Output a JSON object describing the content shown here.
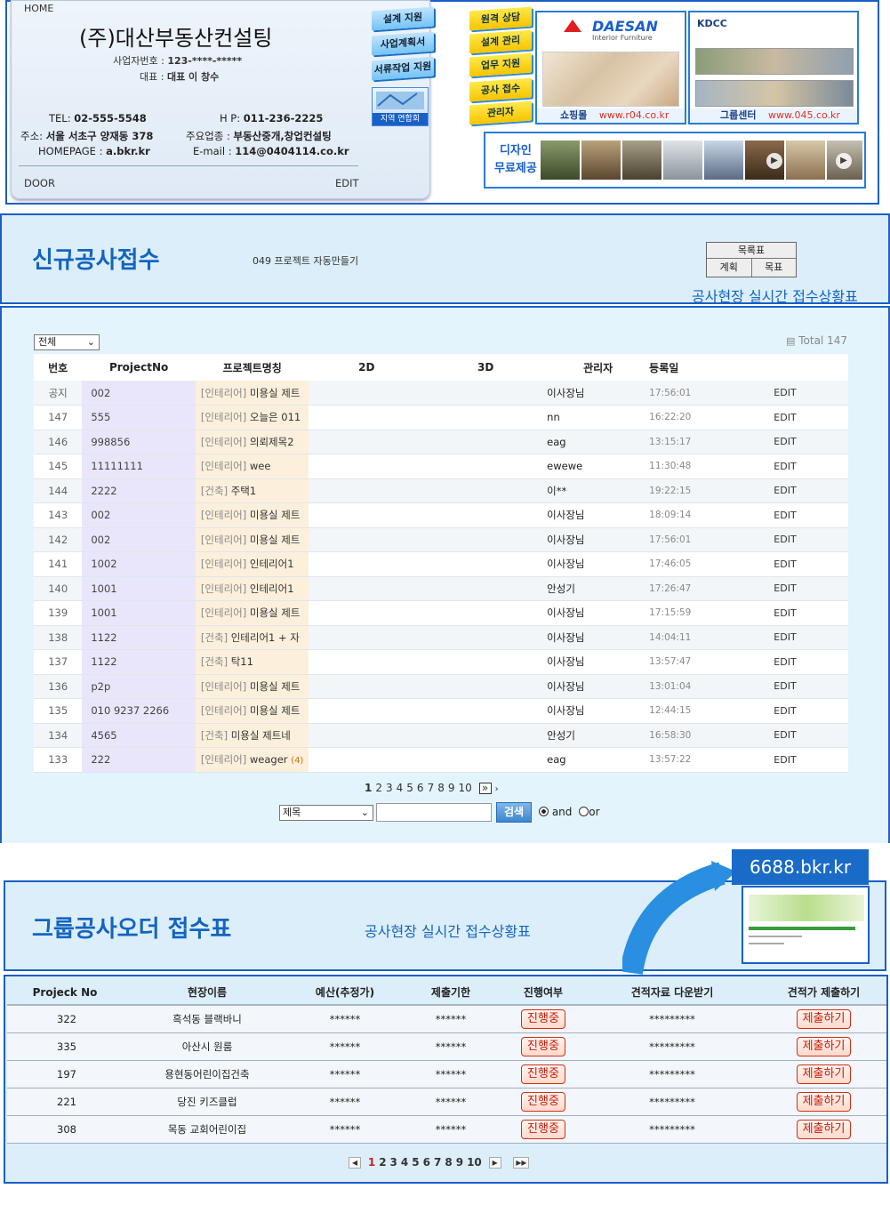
{
  "card": {
    "home": "HOME",
    "company": "(주)대산부동산컨설팅",
    "bizno_label": "사업자번호 : ",
    "bizno": "123-****-*****",
    "ceo_label": "대표 : ",
    "ceo": "대표 이 창수",
    "tel_label": "TEL: ",
    "tel": "02-555-5548",
    "hp_label": "H P: ",
    "hp": "011-236-2225",
    "addr_label": "주소: ",
    "addr": "서울 서초구 양재동 378",
    "biz_label": "주요업종 : ",
    "biz": "부동산중개,창업컨설팅",
    "homepage_label": "HOMEPAGE : ",
    "homepage": "a.bkr.kr",
    "email_label": "E-mail : ",
    "email": "114@0404114.co.kr",
    "door": "DOOR",
    "edit": "EDIT"
  },
  "side_buttons": [
    "설계 지원",
    "사업계획서",
    "서류작업 지원"
  ],
  "region_banner": "지역 연합회",
  "yellow_buttons": [
    "원격 상담",
    "설계 관리",
    "업무 지원",
    "공사 접수",
    "관리자"
  ],
  "daesan": {
    "brand": "DAESAN",
    "sub": "Interior Furniture",
    "label": "쇼핑몰",
    "url": "www.r04.co.kr"
  },
  "kdcc": {
    "brand": "KDCC",
    "label": "그룹센터",
    "url": "www.045.co.kr"
  },
  "design": {
    "line1": "디자인",
    "line2": "무료제공"
  },
  "section1": {
    "title": "신규공사접수",
    "subtitle": "049 프로젝트 자동만들기",
    "menu_top": "목록표",
    "menu_left": "계획",
    "menu_right": "목표",
    "realtime": "공사현장 실시간 접수상황표",
    "filter": "전체",
    "total": "Total 147",
    "headers": [
      "번호",
      "ProjectNo",
      "프로젝트명칭",
      "2D",
      "3D",
      "관리자",
      "등록일"
    ],
    "rows": [
      {
        "no": "공지",
        "pno": "002",
        "cat": "[인테리어]",
        "name": " 미용실 제트",
        "mgr": "이사장님",
        "date": "17:56:01",
        "edit": "EDIT"
      },
      {
        "no": "147",
        "pno": "555",
        "cat": "[인테리어]",
        "name": " 오늘은 011",
        "mgr": "nn",
        "date": "16:22:20",
        "edit": "EDIT"
      },
      {
        "no": "146",
        "pno": "998856",
        "cat": "[인테리어]",
        "name": " 의뢰제목2",
        "mgr": "eag",
        "date": "13:15:17",
        "edit": "EDIT"
      },
      {
        "no": "145",
        "pno": "11111111",
        "cat": "[인테리어]",
        "name": " wee",
        "mgr": "ewewe",
        "date": "11:30:48",
        "edit": "EDIT"
      },
      {
        "no": "144",
        "pno": "2222",
        "cat": "[건축]",
        "name": " 주택1",
        "mgr": "이**",
        "date": "19:22:15",
        "edit": "EDIT"
      },
      {
        "no": "143",
        "pno": "002",
        "cat": "[인테리어]",
        "name": " 미용실 제트",
        "mgr": "이사장님",
        "date": "18:09:14",
        "edit": "EDIT"
      },
      {
        "no": "142",
        "pno": "002",
        "cat": "[인테리어]",
        "name": " 미용실 제트",
        "mgr": "이사장님",
        "date": "17:56:01",
        "edit": "EDIT"
      },
      {
        "no": "141",
        "pno": "1002",
        "cat": "[인테리어]",
        "name": " 인테리어1",
        "mgr": "이사장님",
        "date": "17:46:05",
        "edit": "EDIT"
      },
      {
        "no": "140",
        "pno": "1001",
        "cat": "[인테리어]",
        "name": " 인테리어1",
        "mgr": "안성기",
        "date": "17:26:47",
        "edit": "EDIT"
      },
      {
        "no": "139",
        "pno": "1001",
        "cat": "[인테리어]",
        "name": " 미용실 제트",
        "mgr": "이사장님",
        "date": "17:15:59",
        "edit": "EDIT"
      },
      {
        "no": "138",
        "pno": "1122",
        "cat": "[건축]",
        "name": " 인테리어1 + 자",
        "mgr": "이사장님",
        "date": "14:04:11",
        "edit": "EDIT"
      },
      {
        "no": "137",
        "pno": "1122",
        "cat": "[건축]",
        "name": " 탁11",
        "mgr": "이사장님",
        "date": "13:57:47",
        "edit": "EDIT"
      },
      {
        "no": "136",
        "pno": "p2p",
        "cat": "[인테리어]",
        "name": " 미용실 제트",
        "mgr": "이사장님",
        "date": "13:01:04",
        "edit": "EDIT"
      },
      {
        "no": "135",
        "pno": "010 9237 2266",
        "cat": "[인테리어]",
        "name": " 미용실 제트",
        "mgr": "이사장님",
        "date": "12:44:15",
        "edit": "EDIT"
      },
      {
        "no": "134",
        "pno": "4565",
        "cat": "[건축]",
        "name": " 미용실 제트네",
        "mgr": "안성기",
        "date": "16:58:30",
        "edit": "EDIT"
      },
      {
        "no": "133",
        "pno": "222",
        "cat": "[인테리어]",
        "name": " weager",
        "comment": "(4)",
        "mgr": "eag",
        "date": "13:57:22",
        "edit": "EDIT"
      }
    ],
    "pages": [
      "1",
      "2",
      "3",
      "4",
      "5",
      "6",
      "7",
      "8",
      "9",
      "10"
    ],
    "search_field": "제목",
    "search_button": "검색",
    "and_label": "and",
    "or_label": "or"
  },
  "section2": {
    "title": "그룹공사오더 접수표",
    "realtime": "공사현장 실시간 접수상황표",
    "site": "6688.bkr.kr",
    "headers": [
      "Projeck No",
      "현장이름",
      "예산(추정가)",
      "제출기한",
      "진행여부",
      "견적자료 다운받기",
      "견적가 제출하기"
    ],
    "rows": [
      {
        "no": "322",
        "name": "흑석동 블랙바니",
        "budget": "******",
        "due": "******",
        "status": "진행중",
        "download": "*********",
        "submit": "제출하기"
      },
      {
        "no": "335",
        "name": "아산시 원룸",
        "budget": "******",
        "due": "******",
        "status": "진행중",
        "download": "*********",
        "submit": "제출하기"
      },
      {
        "no": "197",
        "name": "용현동어린이집건축",
        "budget": "******",
        "due": "******",
        "status": "진행중",
        "download": "*********",
        "submit": "제출하기"
      },
      {
        "no": "221",
        "name": "당진 키즈클럽",
        "budget": "******",
        "due": "******",
        "status": "진행중",
        "download": "*********",
        "submit": "제출하기"
      },
      {
        "no": "308",
        "name": "목동 교회어린이집",
        "budget": "******",
        "due": "******",
        "status": "진행중",
        "download": "*********",
        "submit": "제출하기"
      }
    ],
    "pages": [
      "1",
      "2",
      "3",
      "4",
      "5",
      "6",
      "7",
      "8",
      "9",
      "10"
    ]
  },
  "colors": {
    "brand_blue": "#1a5fc8",
    "title_blue": "#1564c0",
    "accent_red": "#c51c0a"
  },
  "icons": [
    "list-icon",
    "next-page-icon",
    "last-page-icon",
    "prev-page-icon",
    "play-icon",
    "arrow-icon"
  ]
}
